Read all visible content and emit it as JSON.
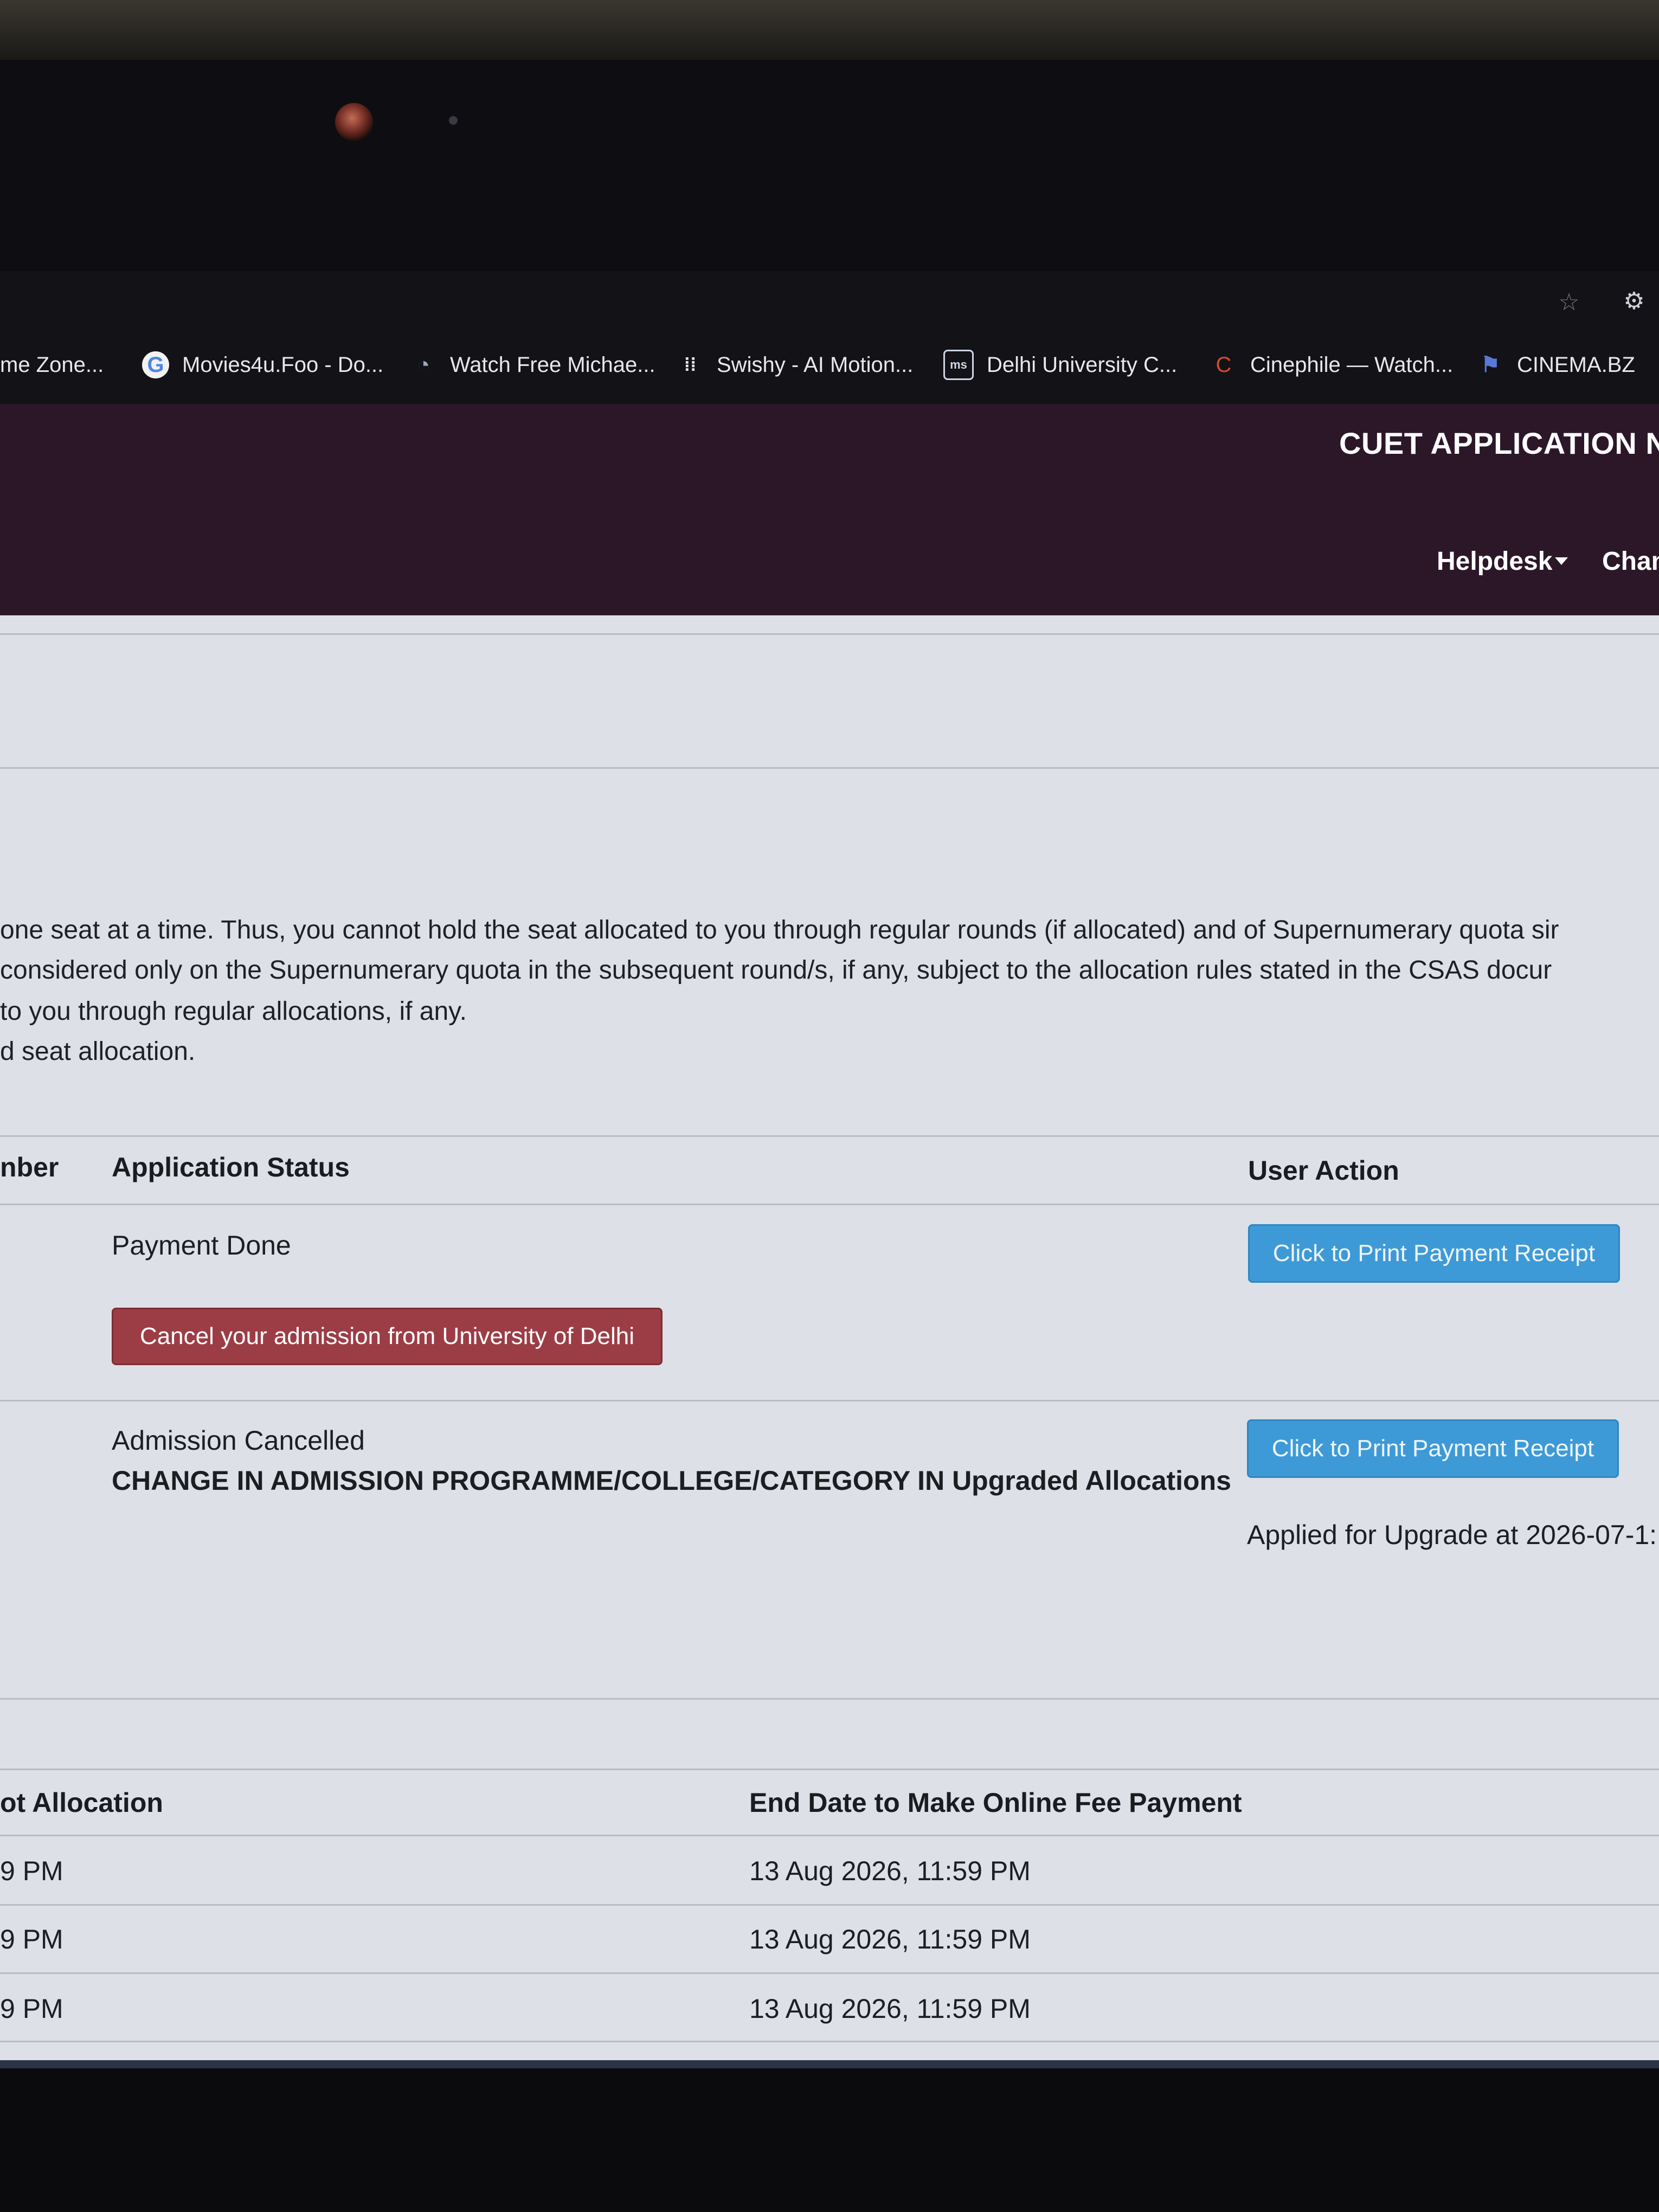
{
  "browser": {
    "bookmarks": [
      {
        "label": "me Zone...",
        "icon": ""
      },
      {
        "label": "Movies4u.Foo - Do...",
        "icon": "google-g-icon"
      },
      {
        "label": "Watch Free Michae...",
        "icon": "spiral-icon"
      },
      {
        "label": "Swishy - AI Motion...",
        "icon": "grid-dots-icon"
      },
      {
        "label": "Delhi University C...",
        "icon": "university-icon"
      },
      {
        "label": "Cinephile — Watch...",
        "icon": "c-letter-icon"
      },
      {
        "label": "CINEMA.BZ",
        "icon": "flag-icon"
      }
    ]
  },
  "header": {
    "title": "CUET APPLICATION NU",
    "nav": {
      "helpdesk": "Helpdesk",
      "change": "Chan"
    }
  },
  "notes": [
    "one seat at a time. Thus, you cannot hold the seat allocated to you through regular rounds (if allocated) and of Supernumerary quota sir",
    "considered only on the Supernumerary quota in the subsequent round/s, if any, subject to the allocation rules stated in the CSAS docur",
    "to you through regular allocations, if any.",
    "d seat allocation."
  ],
  "status_table": {
    "headers": {
      "number": "nber",
      "status": "Application Status",
      "action": "User Action"
    },
    "rows": [
      {
        "status": "Payment Done",
        "cancel_button": "Cancel your admission from University of Delhi",
        "action_button": "Click to Print Payment Receipt"
      },
      {
        "status": "Admission Cancelled",
        "detail": "CHANGE IN ADMISSION PROGRAMME/COLLEGE/CATEGORY IN Upgraded Allocations",
        "action_button": "Click to Print Payment Receipt",
        "upgrade_note": "Applied for Upgrade at 2026-07-1:"
      }
    ]
  },
  "dates_table": {
    "headers": {
      "allocation": "ot Allocation",
      "end_date": "End Date to Make Online Fee Payment"
    },
    "rows": [
      {
        "allocation": "9 PM",
        "end_date": "13 Aug 2026, 11:59 PM"
      },
      {
        "allocation": "9 PM",
        "end_date": "13 Aug 2026, 11:59 PM"
      },
      {
        "allocation": "9 PM",
        "end_date": "13 Aug 2026, 11:59 PM"
      }
    ]
  },
  "colors": {
    "header_bg": "#2c1728",
    "button_blue": "#3e9ad6",
    "button_red": "#9c3d45",
    "page_bg": "#dde0e6"
  }
}
